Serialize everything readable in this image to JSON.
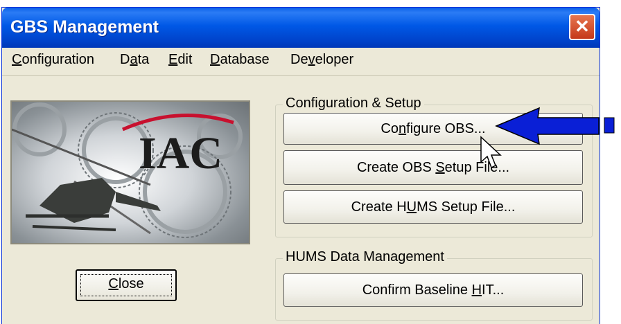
{
  "window": {
    "title": "GBS Management"
  },
  "menu": [
    {
      "label": "Configuration"
    },
    {
      "label": "Data"
    },
    {
      "label": "Edit"
    },
    {
      "label": "Database"
    },
    {
      "label": "Developer"
    }
  ],
  "logo": {
    "text": "IAC"
  },
  "config_group": {
    "label": "Configuration & Setup",
    "buttons": [
      {
        "label": "Configure OBS..."
      },
      {
        "label": "Create OBS Setup File..."
      },
      {
        "label": "Create HUMS Setup File..."
      }
    ]
  },
  "hums_group": {
    "label": "HUMS Data Management",
    "buttons": [
      {
        "label": "Confirm Baseline HIT..."
      }
    ]
  },
  "close_button": {
    "label": "Close"
  },
  "colors": {
    "titlebar": "#0058e6",
    "arrow": "#0a1fd6",
    "window_bg": "#ece9d8",
    "logo_red": "#c8102e"
  }
}
